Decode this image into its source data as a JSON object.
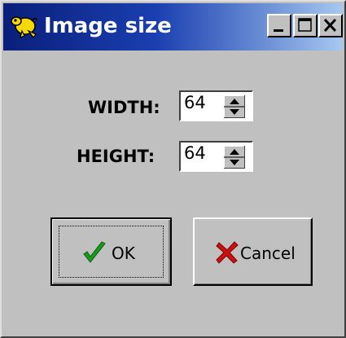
{
  "window": {
    "title": "Image size",
    "app_icon": "yellow-creature-icon",
    "controls": {
      "minimize_icon": "minimize-icon",
      "maximize_icon": "maximize-icon",
      "close_icon": "close-icon"
    }
  },
  "form": {
    "width_label": "WIDTH:",
    "width_value": "64",
    "height_label": "HEIGHT:",
    "height_value": "64"
  },
  "buttons": {
    "ok_label": "OK",
    "ok_icon": "green-checkmark-icon",
    "cancel_label": "Cancel",
    "cancel_icon": "red-x-icon"
  },
  "colors": {
    "titlebar_start": "#0a1f7a",
    "titlebar_end": "#a6c8f0",
    "face": "#c0c0c0",
    "check_green": "#1a9a1a",
    "cancel_red": "#cc1010"
  }
}
